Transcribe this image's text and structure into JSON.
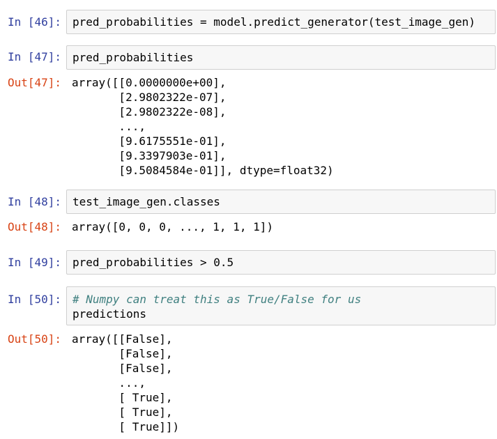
{
  "cells": [
    {
      "in_prompt": "In [46]:",
      "code": [
        "pred_probabilities = model.predict_generator(test_image_gen)"
      ]
    },
    {
      "in_prompt": "In [47]:",
      "code": [
        "pred_probabilities"
      ],
      "out_prompt": "Out[47]:",
      "output": [
        "array([[0.0000000e+00],",
        "       [2.9802322e-07],",
        "       [2.9802322e-08],",
        "       ...,",
        "       [9.6175551e-01],",
        "       [9.3397903e-01],",
        "       [9.5084584e-01]], dtype=float32)"
      ]
    },
    {
      "in_prompt": "In [48]:",
      "code": [
        "test_image_gen.classes"
      ],
      "out_prompt": "Out[48]:",
      "output": [
        "array([0, 0, 0, ..., 1, 1, 1])"
      ]
    },
    {
      "in_prompt": "In [49]:",
      "code": [
        "pred_probabilities > 0.5"
      ]
    },
    {
      "in_prompt": "In [50]:",
      "code": [
        "# Numpy can treat this as True/False for us",
        "predictions"
      ],
      "out_prompt": "Out[50]:",
      "output": [
        "array([[False],",
        "       [False],",
        "       [False],",
        "       ...,",
        "       [ True],",
        "       [ True],",
        "       [ True]])"
      ]
    }
  ]
}
